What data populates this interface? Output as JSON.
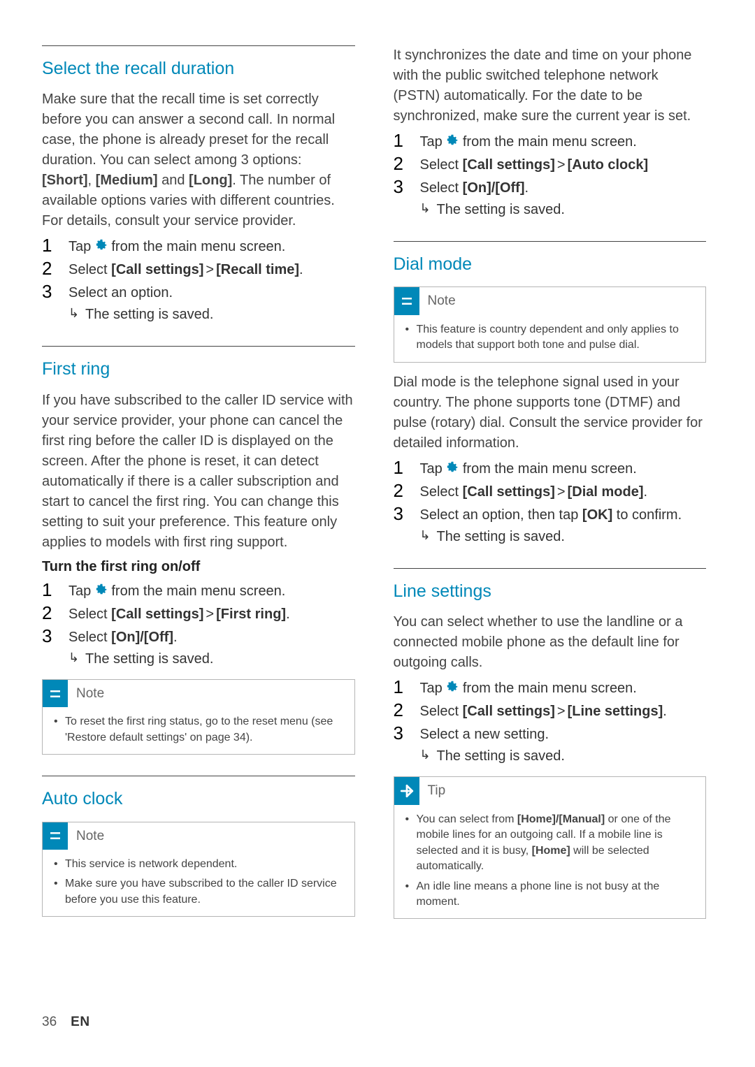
{
  "page_number": "36",
  "page_lang": "EN",
  "icon_names": {
    "gear": "gear-icon",
    "note": "note-icon",
    "tip": "tip-icon",
    "result": "result-arrow"
  },
  "left": {
    "recall": {
      "title": "Select the recall duration",
      "intro": "Make sure that the recall time is set correctly before you can answer a second call. In normal case, the phone is already preset for the recall duration. You can select among 3 options: ",
      "opt1": "[Short]",
      "opt2": "[Medium]",
      "opt3": "[Long]",
      "sep": ", ",
      "and": " and ",
      "intro2": ". The number of available options varies with different countries. For details, consult your service provider.",
      "steps": [
        {
          "pre": "Tap ",
          "post": " from the main menu screen."
        },
        {
          "pre": "Select ",
          "path1": "[Call settings]",
          "gt": ">",
          "path2": "[Recall time]",
          "end": "."
        },
        {
          "pre": "Select an option."
        }
      ],
      "result": "The setting is saved."
    },
    "first_ring": {
      "title": "First ring",
      "intro": "If you have subscribed to the caller ID service with your service provider, your phone can cancel the first ring before the caller ID is displayed on the screen. After the phone is reset, it can detect automatically if there is a caller subscription and start to cancel the first ring. You can change this setting to suit your preference. This feature only applies to models with first ring support.",
      "sub": "Turn the first ring on/off",
      "steps": [
        {
          "pre": "Tap ",
          "post": " from the main menu screen."
        },
        {
          "pre": "Select ",
          "path1": "[Call settings]",
          "gt": ">",
          "path2": "[First ring]",
          "end": "."
        },
        {
          "pre": "Select ",
          "opt": "[On]/[Off]",
          "end": "."
        }
      ],
      "result": "The setting is saved.",
      "note_label": "Note",
      "note_items": [
        "To reset the first ring status, go to the reset menu (see 'Restore default settings' on page 34)."
      ]
    },
    "auto_clock": {
      "title": "Auto clock",
      "note_label": "Note",
      "note_items": [
        "This service is network dependent.",
        "Make sure you have subscribed to the caller ID service before you use this feature."
      ]
    }
  },
  "right": {
    "auto_clock_cont": {
      "intro": "It synchronizes the date and time on your phone with the public switched telephone network (PSTN) automatically. For the date to be synchronized, make sure the current year is set.",
      "steps": [
        {
          "pre": "Tap ",
          "post": " from the main menu screen."
        },
        {
          "pre": "Select ",
          "path1": "[Call settings]",
          "gt": ">",
          "path2": "[Auto clock]"
        },
        {
          "pre": "Select ",
          "opt": "[On]/[Off]",
          "end": "."
        }
      ],
      "result": "The setting is saved."
    },
    "dial_mode": {
      "title": "Dial mode",
      "note_label": "Note",
      "note_items": [
        "This feature is country dependent and only applies to models that support both tone and pulse dial."
      ],
      "intro": "Dial mode is the telephone signal used in your country. The phone supports tone (DTMF) and pulse (rotary) dial. Consult the service provider for detailed information.",
      "steps": [
        {
          "pre": "Tap ",
          "post": " from the main menu screen."
        },
        {
          "pre": "Select ",
          "path1": "[Call settings]",
          "gt": ">",
          "path2": "[Dial mode]",
          "end": "."
        },
        {
          "pre": "Select an option, then tap ",
          "opt": "[OK]",
          "post2": " to confirm."
        }
      ],
      "result": "The setting is saved."
    },
    "line": {
      "title": "Line settings",
      "intro": "You can select whether to use the landline or a connected mobile phone as the default line for outgoing calls.",
      "steps": [
        {
          "pre": "Tap ",
          "post": " from the main menu screen."
        },
        {
          "pre": "Select ",
          "path1": "[Call settings]",
          "gt": ">",
          "path2": "[Line settings]",
          "end": "."
        },
        {
          "pre": "Select a new setting."
        }
      ],
      "result": "The setting is saved.",
      "tip_label": "Tip",
      "tip_items": [
        {
          "pre": "You can select from ",
          "opt1": "[Home]/[Manual]",
          "mid": " or one of the mobile lines for an outgoing call. If a mobile line is selected and it is busy, ",
          "opt2": "[Home]",
          "post": " will be selected automatically."
        },
        {
          "pre": "An idle line means a phone line is not busy at the moment."
        }
      ]
    }
  }
}
